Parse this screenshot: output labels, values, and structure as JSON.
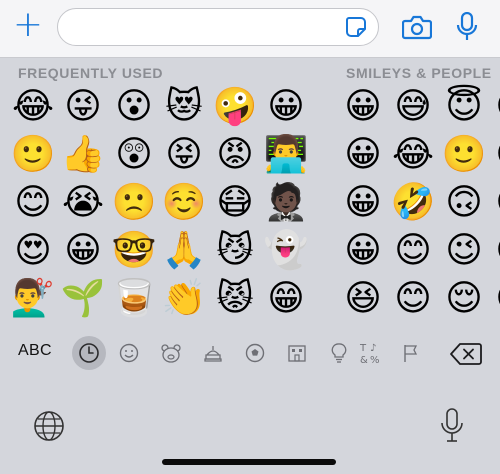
{
  "composer": {
    "message_value": "",
    "message_placeholder": ""
  },
  "categories": {
    "frequent_label": "FREQUENTLY USED",
    "smileys_label": "SMILEYS & PEOPLE"
  },
  "emoji_grid": {
    "frequent": [
      [
        "😂",
        "😜",
        "😮",
        "😻",
        "🤪",
        "😀"
      ],
      [
        "🙂",
        "👍",
        "😲",
        "😝",
        "😡",
        "👨‍💻"
      ],
      [
        "😊",
        "😭",
        "🙁",
        "☺️",
        "😷",
        "🤵🏿"
      ],
      [
        "😍",
        "😀",
        "🤓",
        "🙏",
        "😼",
        "👻"
      ],
      [
        "💇‍♂️",
        "🌱",
        "🥃",
        "👏",
        "😾",
        "😁"
      ]
    ],
    "smileys": [
      [
        "😀",
        "😅",
        "😇",
        "😉"
      ],
      [
        "😀",
        "😂",
        "🙂",
        "😍"
      ],
      [
        "😀",
        "🤣",
        "🙃",
        "😘"
      ],
      [
        "😀",
        "😊",
        "😉",
        "😚"
      ],
      [
        "😆",
        "😊",
        "😌",
        "😛"
      ]
    ]
  },
  "category_bar": {
    "abc_label": "ABC",
    "icons": [
      "clock-icon",
      "smiley-icon",
      "bear-icon",
      "food-icon",
      "ball-icon",
      "building-icon",
      "bulb-icon",
      "symbols-icon",
      "flag-icon"
    ],
    "selected": "clock-icon",
    "symbols_text": "T&%"
  },
  "colors": {
    "accent": "#1877d8",
    "keyboard_bg": "#d4d6dc",
    "label_gray": "#8b8d93"
  }
}
